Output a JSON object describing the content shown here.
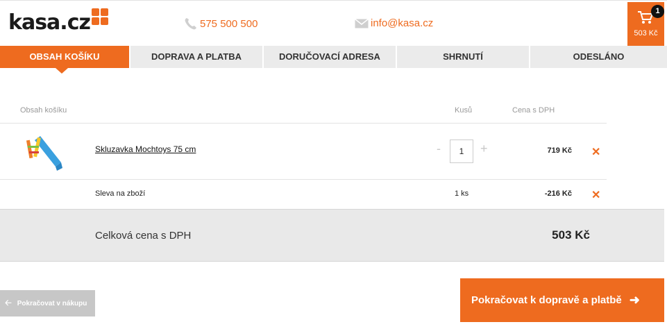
{
  "header": {
    "logo": "kasa.cz",
    "phone": "575 500 500",
    "email": "info@kasa.cz",
    "cart": {
      "count": "1",
      "price": "503 Kč"
    }
  },
  "steps": [
    {
      "label": "Obsah košíku"
    },
    {
      "label": "Doprava a platba"
    },
    {
      "label": "Doručovací adresa"
    },
    {
      "label": "Shrnutí"
    },
    {
      "label": "Odesláno"
    }
  ],
  "table": {
    "col_content": "Obsah košíku",
    "col_qty": "Kusů",
    "col_price": "Cena s DPH"
  },
  "item": {
    "name": "Skluzavka Mochtoys 75 cm",
    "qty": "1",
    "minus": "-",
    "plus": "+",
    "price": "719 Kč",
    "remove": "✕"
  },
  "discount": {
    "label": "Sleva na zboží",
    "qty": "1 ks",
    "price": "-216 Kč",
    "remove": "✕"
  },
  "total": {
    "label": "Celková cena s DPH",
    "price": "503 Kč"
  },
  "buttons": {
    "back": "Pokračovat v nákupu",
    "next": "Pokračovat k dopravě a platbě"
  },
  "colors": {
    "accent": "#ee6b1f",
    "step_bg": "#ebebeb",
    "total_bg": "#e9e9e9"
  }
}
